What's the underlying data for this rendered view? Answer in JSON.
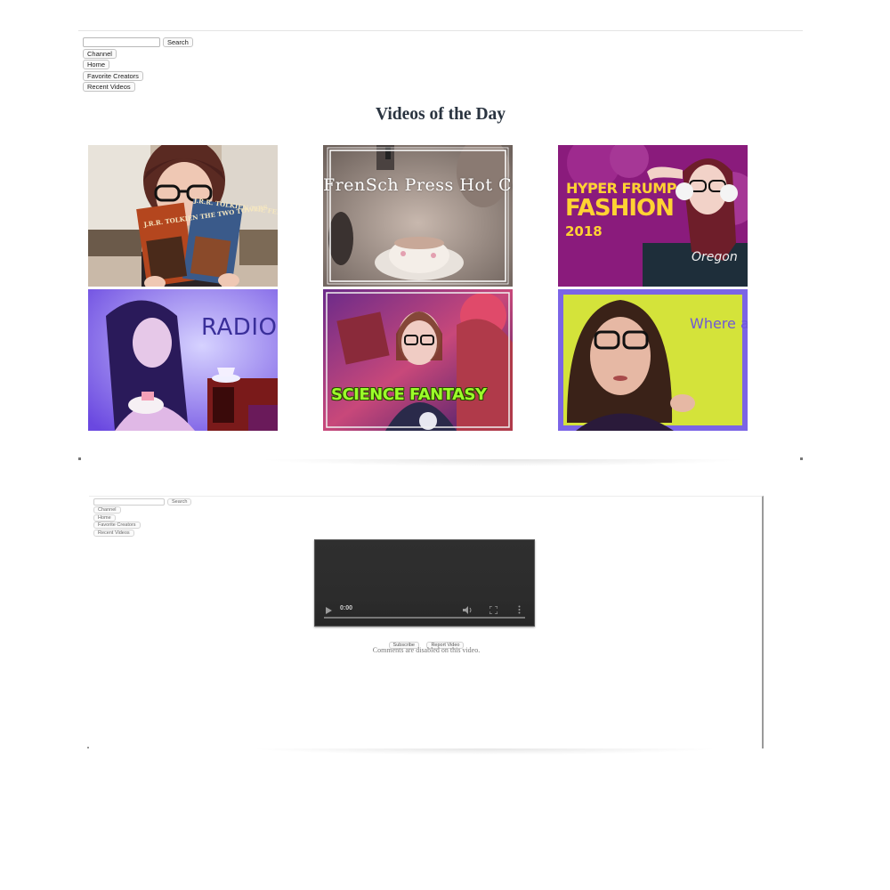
{
  "top": {
    "search": {
      "value": "",
      "button": "Search"
    },
    "nav": [
      "Channel",
      "Home",
      "Favorite Creators",
      "Recent Videos"
    ],
    "title": "Videos of the Day",
    "videos": [
      {
        "subject": "two-towers-books",
        "book_titles": [
          "J.R.R. TOLKIEN\nTHE TWO TOWERS",
          "J.R.R. TOLKIEN\nTHE FELLOWSHIP\nOF THE RING"
        ]
      },
      {
        "subject": "french-press-hot-cocoa",
        "caption": "FrenSch Press\nHot Cocoa"
      },
      {
        "subject": "hyper-frump-fashion",
        "caption_line1": "HYPER FRUMP",
        "caption_line2": "FASHION",
        "caption_line3": "2018",
        "shirt_text": "Oregon"
      },
      {
        "subject": "radio",
        "caption": "RADIO"
      },
      {
        "subject": "science-fantasy",
        "caption": "SCIENCE FANTASY"
      },
      {
        "subject": "where-am-i",
        "caption": "Where\nam\nI?"
      }
    ],
    "colors": {
      "title": "#2a3440",
      "frump_bg": "#8a1b7c",
      "frump_text": "#ffd233",
      "radio_bg": "#7c5ae6",
      "scifi_text": "#9cff2a",
      "where_border": "#7b64e6",
      "where_bg": "#d4e33a"
    }
  },
  "bottom": {
    "search": {
      "value": "",
      "button": "Search"
    },
    "nav": [
      "Channel",
      "Home",
      "Favorite Creators",
      "Recent Videos"
    ],
    "player": {
      "time": "0:00"
    },
    "actions": [
      "Subscribe",
      "Report Video"
    ],
    "comments_note": "Comments are disabled on this video."
  }
}
